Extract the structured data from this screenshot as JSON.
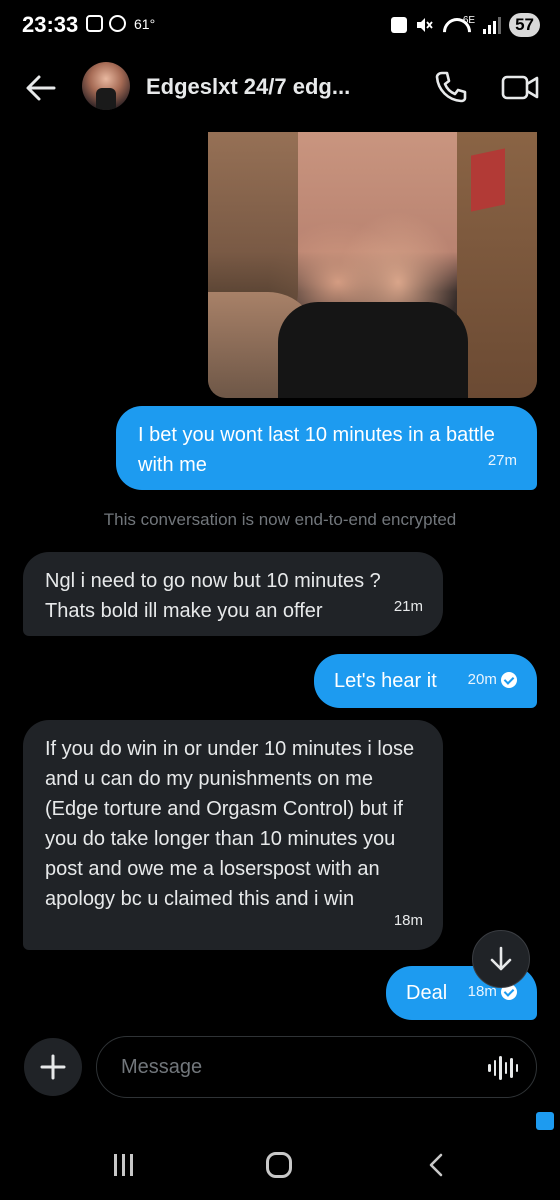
{
  "status_bar": {
    "time": "23:33",
    "temperature": "61°",
    "network": "6E",
    "battery": "57"
  },
  "header": {
    "title": "Edgeslxt 24/7 edg...",
    "icons": [
      "back-arrow-icon",
      "avatar",
      "phone-icon",
      "video-icon"
    ]
  },
  "messages": [
    {
      "direction": "out",
      "text": "I bet you wont last 10 minutes in a battle with me",
      "time": "27m"
    },
    {
      "direction": "in",
      "text": "Ngl i need to go now but 10 minutes ? Thats bold ill make you an offer",
      "time": "21m"
    },
    {
      "direction": "out",
      "text": "Let's hear it",
      "time": "20m"
    },
    {
      "direction": "in",
      "text": "If you do win in or under 10 minutes i lose and u can do my punishments on me (Edge torture and Orgasm Control) but if you do take longer than 10 minutes you post and owe me a loserspost with an apology bc u claimed this and i win",
      "time": "18m"
    },
    {
      "direction": "out",
      "text": "Deal",
      "time": "18m"
    }
  ],
  "system_notice": "This conversation is now end-to-end encrypted",
  "composer": {
    "placeholder": "Message"
  },
  "colors": {
    "background": "#000000",
    "outgoing_bubble": "#1d9bf0",
    "incoming_bubble": "#202327",
    "muted_text": "#71767b"
  }
}
